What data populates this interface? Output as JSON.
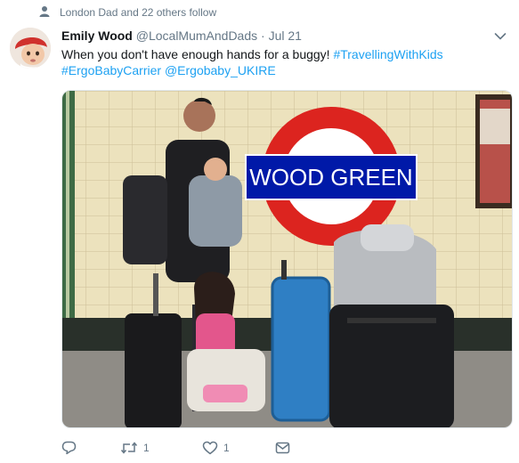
{
  "social_context": {
    "text": "London Dad and 22 others follow"
  },
  "tweet": {
    "display_name": "Emily Wood",
    "handle": "@LocalMumAndDads",
    "separator": "·",
    "date": "Jul 21",
    "text_plain": "When you don't have enough hands for a buggy!",
    "hashtag_1": "#TravellingWithKids",
    "hashtag_2": "#ErgoBabyCarrier",
    "mention_1": "@Ergobaby_UKIRE"
  },
  "media": {
    "sign_text": "WOOD GREEN"
  },
  "actions": {
    "reply_count": "",
    "retweet_count": "1",
    "like_count": "1",
    "dm_count": ""
  },
  "colors": {
    "link": "#1da1f2",
    "secondary_text": "#657786",
    "roundel_red": "#dc241f",
    "roundel_blue": "#0019a8"
  },
  "icons": [
    "person-icon",
    "chevron-down-icon",
    "reply-icon",
    "retweet-icon",
    "heart-icon",
    "envelope-icon"
  ]
}
